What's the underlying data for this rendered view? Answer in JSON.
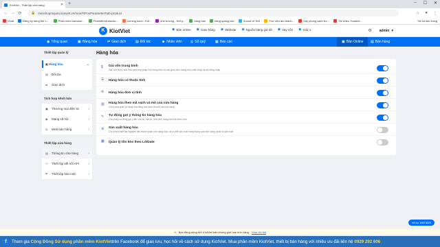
{
  "browser": {
    "tab_title": "KiotViet - Thiết lập cửa hàng",
    "url": "minishopmquan.kiotviet.vn/man/#/PosParameter#tab-product",
    "bookmarks": [
      "Vinaf",
      "Đăng ký dùng thử L...",
      "Phần mềm karaoke...",
      "PhanMemKaraoke...",
      "coming soon - Kiế...",
      "khe trương - Kết p...",
      "bảng báo",
      "bảng quảng cáo",
      "Sound of Text",
      "Thư viện âm thanh...",
      "Xây phòng sạch trọ...",
      "Tải video Youtube..."
    ],
    "bookmarks_right": "Tất cả dấu trang"
  },
  "app": {
    "logo": "KiotViet",
    "header_links": [
      "Bán online",
      "Giao hàng",
      "Website",
      "Nguồn hàng giá tốt",
      "Vay vốn",
      "Giải 1"
    ],
    "user": "admin",
    "nav": [
      "Tổng quan",
      "Hàng hóa",
      "Giao dịch",
      "Đối tác",
      "Nhân viên",
      "Sổ quỹ",
      "Báo cáo"
    ],
    "nav_right": [
      "Bán Online",
      "Bán hàng"
    ]
  },
  "sidebar": {
    "sections": [
      {
        "title": "Thiết lập quản lý",
        "items": [
          "Hàng hóa",
          "Đối tác",
          "Giao dịch"
        ]
      },
      {
        "title": "Tích hợp kênh bán",
        "items": [
          "Thương mại điện tử",
          "Mạng xã hội",
          "Web bán hàng"
        ]
      },
      {
        "title": "Thiết lập cửa hàng",
        "items": [
          "Thông tin cửa hàng",
          "Thiết lập kết nối API",
          "Thiết lập bảo mật"
        ]
      }
    ]
  },
  "content": {
    "title": "Hàng hóa",
    "rows": [
      {
        "title": "Giá vốn trung bình",
        "desc": "Giá vốn được tính theo phương pháp tính trung bình từ các giao dịch mang tính chất nhập và trả hàng nhập",
        "on": true
      },
      {
        "title": "Hàng hóa có thuộc tính",
        "desc": "",
        "on": true
      },
      {
        "title": "Hàng hóa đơn vị tính",
        "desc": "",
        "on": true
      },
      {
        "title": "Hàng hóa theo mã vạch và mã của cửa hàng",
        "desc": "Cho phép quản lý hàng hóa bằng mã vạch và mã của cửa hàng",
        "on": true
      },
      {
        "title": "Tự động gợi ý thông tin hàng hóa",
        "desc": "Cho phép tự động gợi ý tên, mô tả, mã số, hình ảnh hàng hóa khi thêm mới",
        "on": true
      },
      {
        "title": "Sản xuất hàng hóa",
        "desc": "Cho phép thiết lập Nguyên liệu thành phần cho hàng hóa, và có thể sản xuất hàng thông qua tính năng Quản lý sản xuất",
        "on": false
      },
      {
        "title": "Quản lý tồn kho theo Lô/Date",
        "desc": "",
        "on": false
      }
    ]
  },
  "notice": {
    "text": "Bạn đang dùng thử KiotViet bản không giới hạn tính năng.",
    "link": "Xem chi tiết"
  },
  "support": "Hỗ trợ 1900 6522",
  "banner": {
    "prefix": "Tham gia ",
    "highlight": "Cộng Đồng Sử dụng phần mềm KiotViet",
    "suffix": " trên Facebook để giao lưu, học hỏi về cách sử dụng KiotViet. Mua phần mềm KiotViet, thiết bị bán hàng với nhiều ưu đãi liên hệ ",
    "phone": "0929 292 606"
  },
  "colors": {
    "accent": "#0070f4",
    "banner": "#2a70b8"
  }
}
